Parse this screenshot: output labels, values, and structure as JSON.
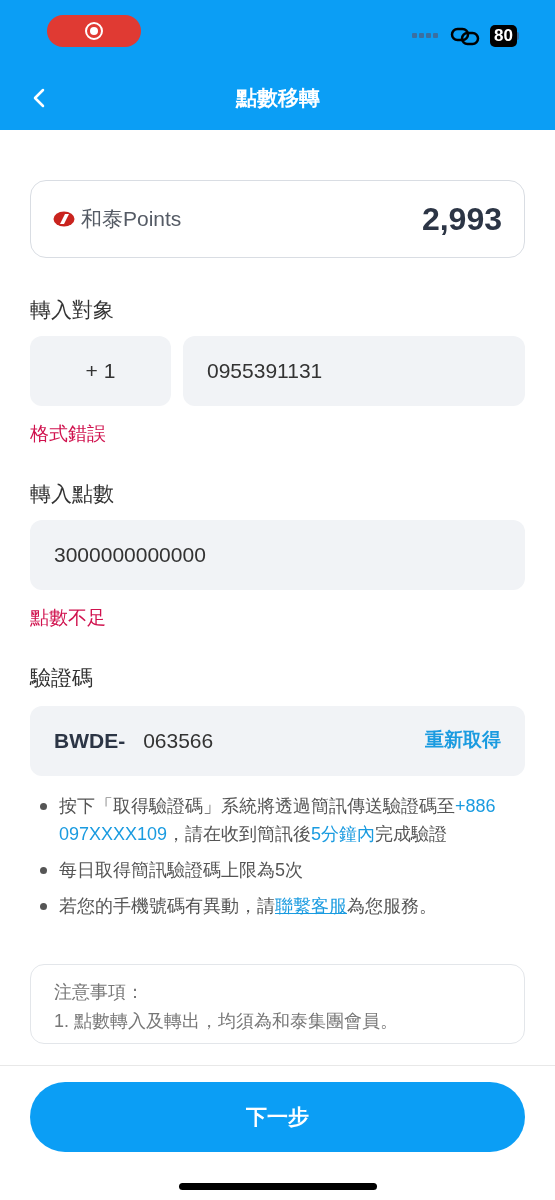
{
  "status_bar": {
    "battery": "80"
  },
  "header": {
    "title": "點數移轉"
  },
  "points_card": {
    "brand": "和泰Points",
    "balance": "2,993"
  },
  "recipient": {
    "label": "轉入對象",
    "country_code": "+ 1",
    "phone": "0955391131",
    "error": "格式錯誤"
  },
  "amount": {
    "label": "轉入點數",
    "value": "3000000000000",
    "error": "點數不足"
  },
  "verification": {
    "label": "驗證碼",
    "prefix": "BWDE-",
    "value": "063566",
    "resend": "重新取得"
  },
  "tips": [
    [
      {
        "kind": "plain",
        "text": "按下「取得驗證碼」系統將透過簡訊傳送驗證碼至"
      },
      {
        "kind": "highlight",
        "text": "+886 097XXXX109"
      },
      {
        "kind": "plain",
        "text": "，請在收到簡訊後"
      },
      {
        "kind": "highlight",
        "text": "5分鐘內"
      },
      {
        "kind": "plain",
        "text": "完成驗證"
      }
    ],
    [
      {
        "kind": "plain",
        "text": "每日取得簡訊驗證碼上限為5次"
      }
    ],
    [
      {
        "kind": "plain",
        "text": "若您的手機號碼有異動，請"
      },
      {
        "kind": "link",
        "text": "聯繫客服"
      },
      {
        "kind": "plain",
        "text": "為您服務。"
      }
    ]
  ],
  "notes": {
    "title": "注意事項：",
    "items": [
      "1. 點數轉入及轉出，均須為和泰集團會員。"
    ]
  },
  "next_button": "下一步"
}
